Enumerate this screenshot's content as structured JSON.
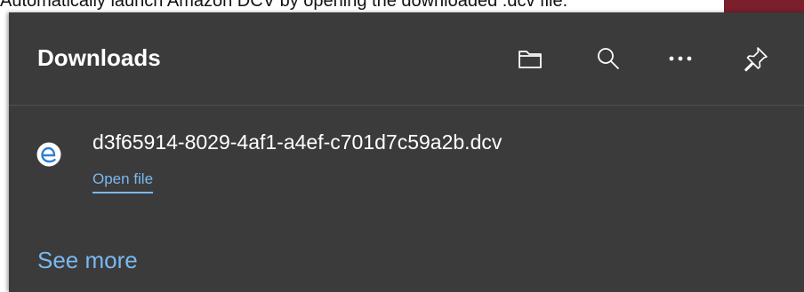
{
  "tooltip": {
    "text": "Automatically launch Amazon DCV by opening the downloaded .dcv file."
  },
  "panel": {
    "title": "Downloads",
    "toolbar": {
      "open_folder_icon": "folder-icon",
      "search_icon": "search-icon",
      "more_icon": "more-options-icon",
      "pin_icon": "pin-icon"
    },
    "items": [
      {
        "file_name": "d3f65914-8029-4af1-a4ef-c701d7c59a2b.dcv",
        "action_label": "Open file",
        "icon": "edge-file-icon"
      }
    ],
    "see_more_label": "See more"
  },
  "colors": {
    "panel_bg": "#3b3b3b",
    "text": "#ffffff",
    "accent": "#79b8f2",
    "top_right_bg": "#7a1f2b"
  }
}
